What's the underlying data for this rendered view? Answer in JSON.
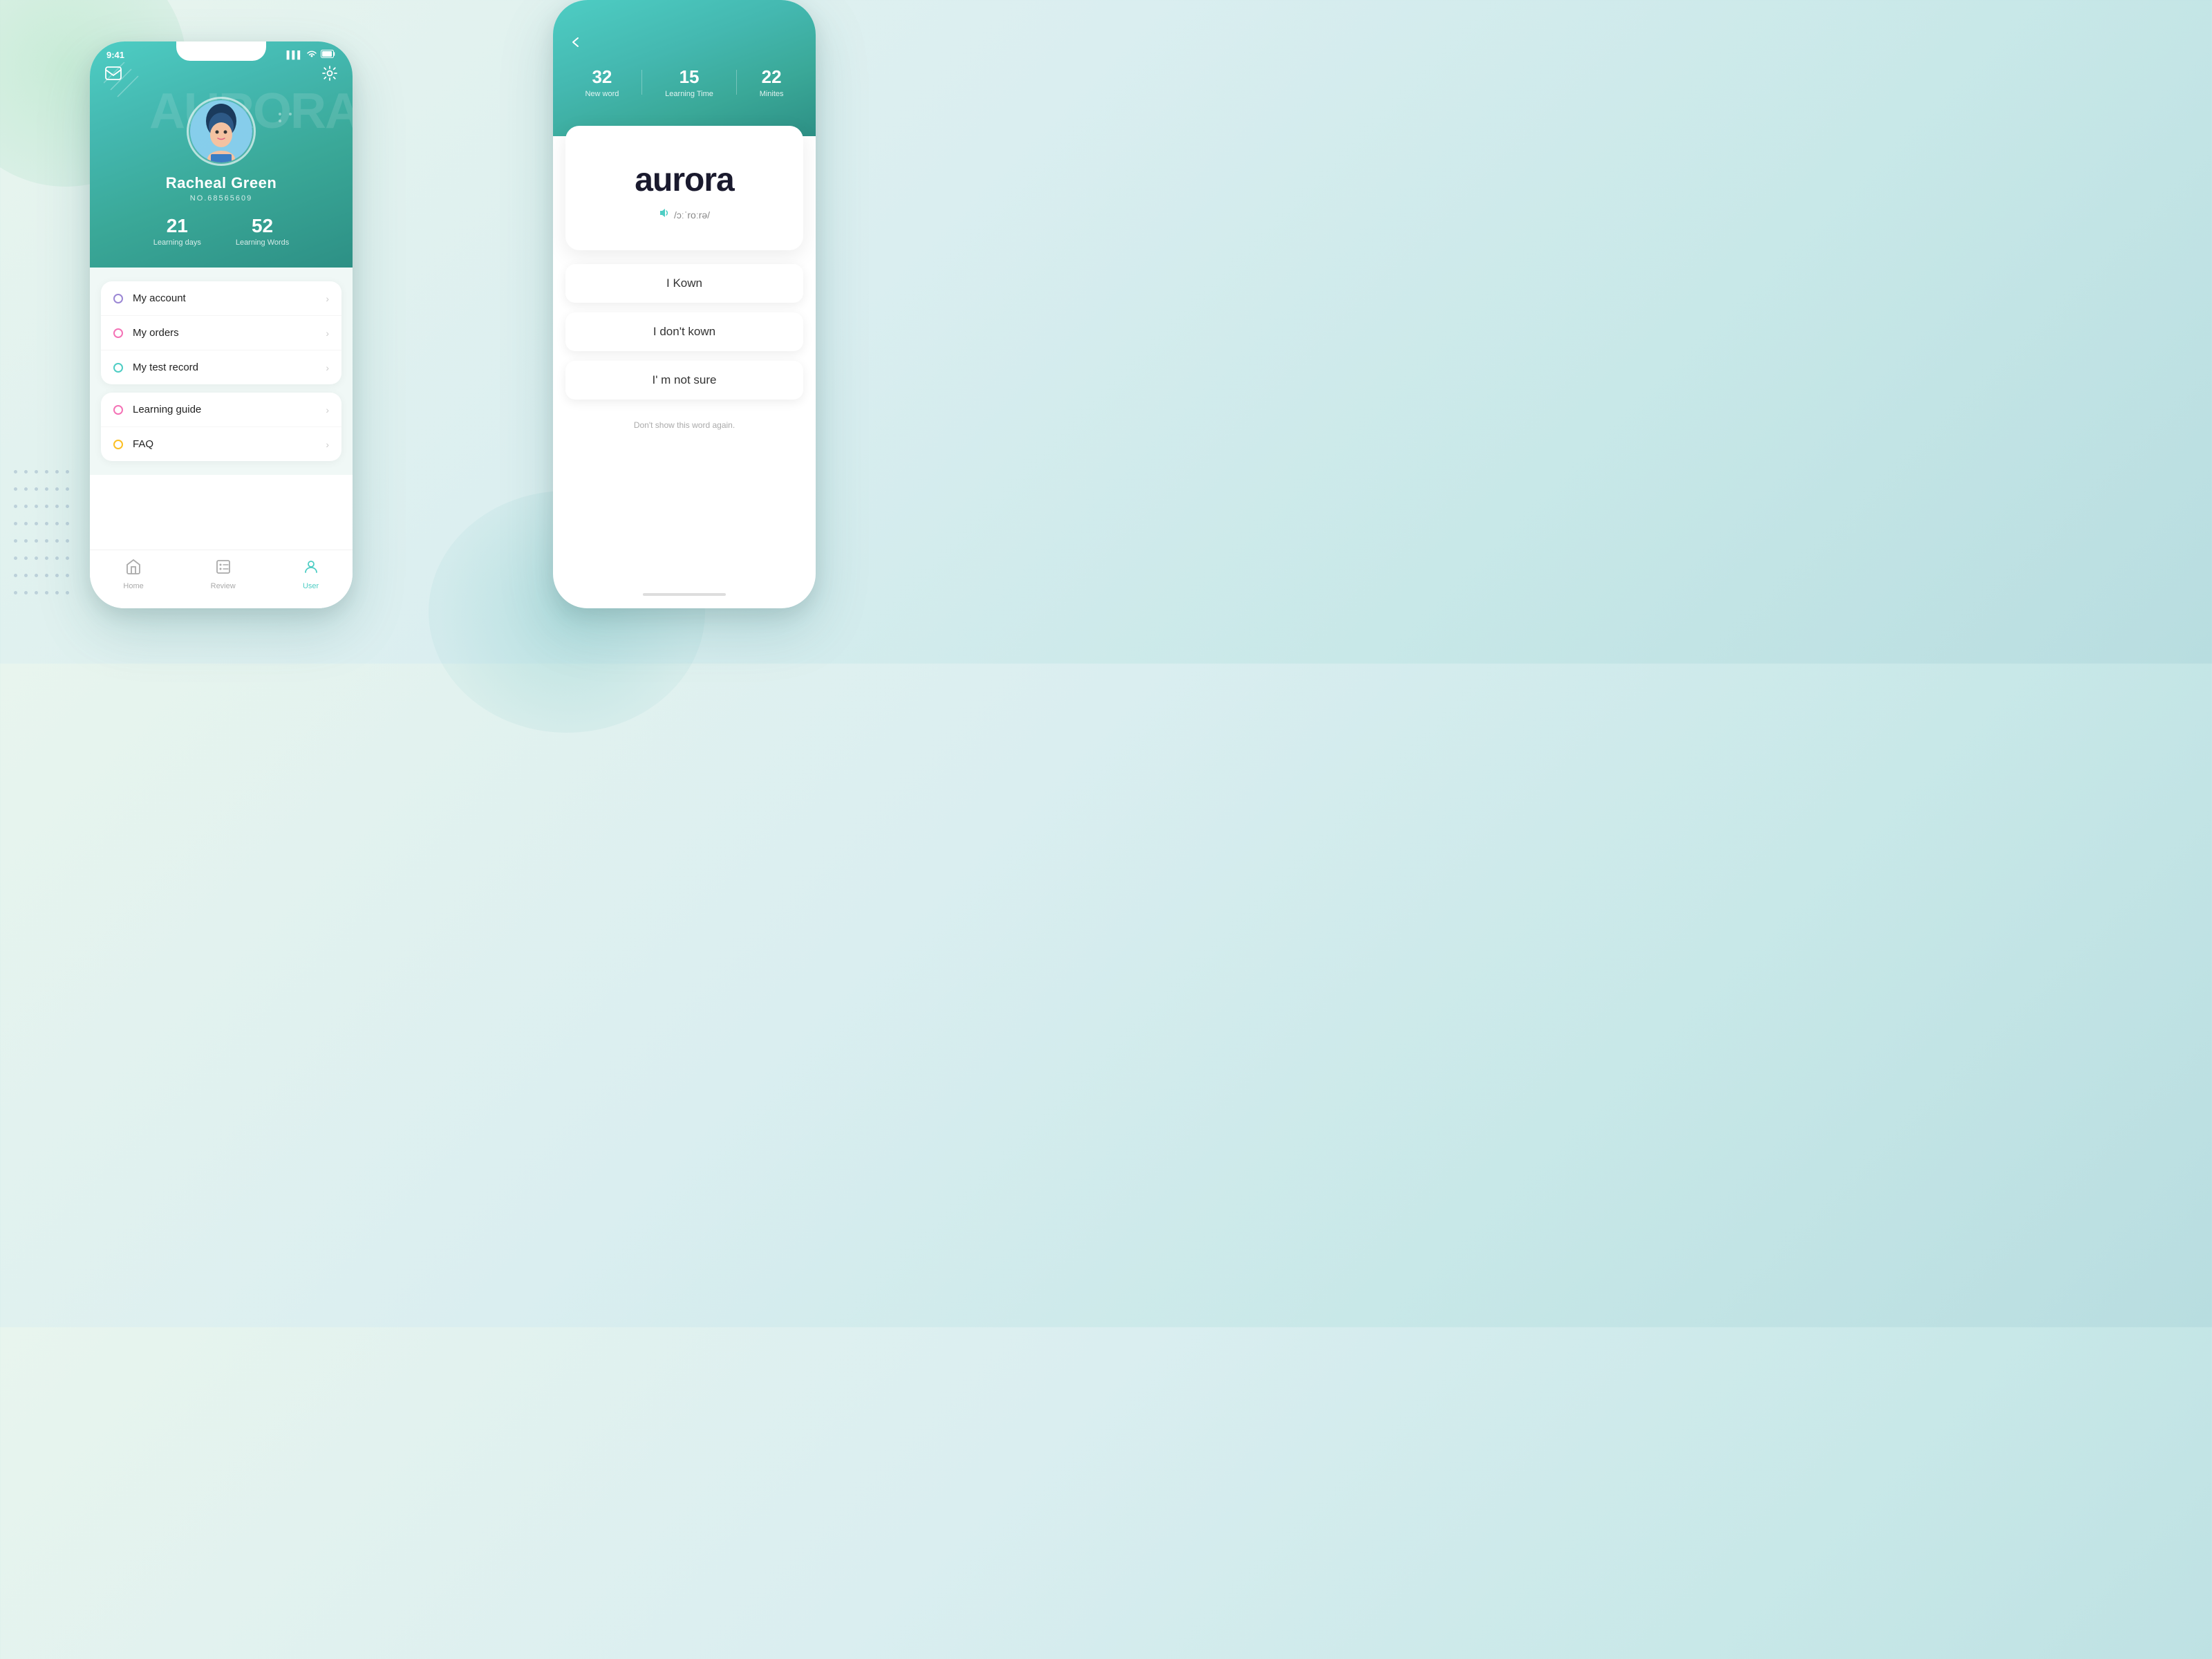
{
  "background": {
    "color_start": "#e8f5ee",
    "color_end": "#b8dde0"
  },
  "phone_left": {
    "status_bar": {
      "time": "9:41",
      "signal_icon": "▌▌▌",
      "wifi_icon": "wifi",
      "battery_icon": "battery"
    },
    "header": {
      "mail_icon": "✉",
      "settings_icon": "⚙",
      "watermark": "AURORA"
    },
    "profile": {
      "name": "Racheal Green",
      "user_no": "NO.68565609",
      "learning_days": "21",
      "learning_days_label": "Learning days",
      "learning_words": "52",
      "learning_words_label": "Learning Words"
    },
    "menu": {
      "group1": [
        {
          "label": "My account",
          "dot_color": "purple"
        },
        {
          "label": "My orders",
          "dot_color": "pink"
        },
        {
          "label": "My test record",
          "dot_color": "teal"
        }
      ],
      "group2": [
        {
          "label": "Learning guide",
          "dot_color": "pink"
        },
        {
          "label": "FAQ",
          "dot_color": "yellow"
        }
      ]
    },
    "bottom_nav": [
      {
        "icon": "home",
        "label": "Home",
        "active": false
      },
      {
        "icon": "review",
        "label": "Review",
        "active": false
      },
      {
        "icon": "user",
        "label": "User",
        "active": true
      }
    ]
  },
  "phone_right": {
    "back_icon": "‹",
    "stats": [
      {
        "number": "32",
        "label": "New word"
      },
      {
        "number": "15",
        "label": "Learning Time"
      },
      {
        "number": "22",
        "label": "Minites"
      }
    ],
    "word_card": {
      "word": "aurora",
      "phonetic": "/ɔːˈroːrə/",
      "sound_icon": "🔊"
    },
    "answers": [
      {
        "label": "I Kown"
      },
      {
        "label": "I don't kown"
      },
      {
        "label": "I' m not sure"
      }
    ],
    "dont_show_label": "Don't show this word again."
  }
}
